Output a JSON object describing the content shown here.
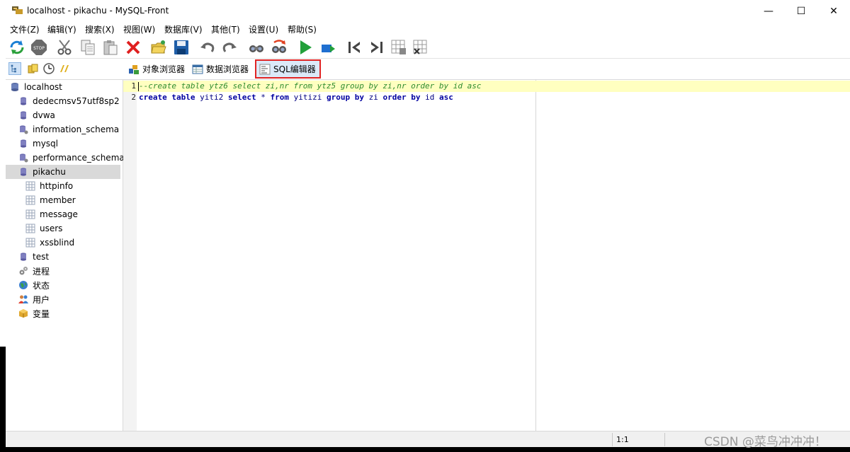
{
  "window": {
    "title": "localhost - pikachu - MySQL-Front",
    "minimize": "—",
    "maximize": "☐",
    "close": "✕"
  },
  "menu": [
    "文件(Z)",
    "编辑(Y)",
    "搜索(X)",
    "视图(W)",
    "数据库(V)",
    "其他(T)",
    "设置(U)",
    "帮助(S)"
  ],
  "toolbar": {
    "icons": [
      "refresh-icon",
      "stop-icon",
      "cut-icon",
      "copy-icon",
      "paste-icon",
      "delete-icon",
      "open-icon",
      "save-icon",
      "undo-icon",
      "redo-icon",
      "find-icon",
      "replace-icon",
      "run-icon",
      "run-selection-icon",
      "first-record-icon",
      "last-record-icon",
      "insert-record-icon",
      "delete-record-icon"
    ]
  },
  "views": {
    "objects": "对象浏览器",
    "data": "数据浏览器",
    "sql": "SQL编辑器"
  },
  "tree": {
    "root": "localhost",
    "databases": [
      "dedecmsv57utf8sp2",
      "dvwa",
      "information_schema",
      "mysql",
      "performance_schema",
      "pikachu"
    ],
    "tables": [
      "httpinfo",
      "member",
      "message",
      "users",
      "xssblind"
    ],
    "after": [
      "test"
    ],
    "extras": [
      "进程",
      "状态",
      "用户",
      "变量"
    ]
  },
  "editor": {
    "lines": [
      {
        "num": "1",
        "text": "--create table ytz6 select zi,nr from ytz5 group by zi,nr order by id asc"
      },
      {
        "num": "2",
        "text": "create table yiti2 select * from yitizi group by zi order by id asc"
      }
    ]
  },
  "status": {
    "position": "1:1"
  },
  "watermark": "CSDN @菜鸟冲冲冲！"
}
